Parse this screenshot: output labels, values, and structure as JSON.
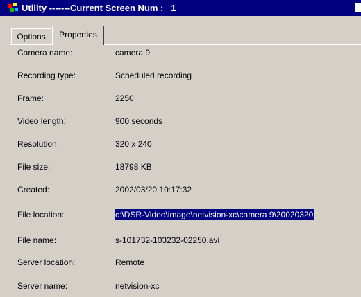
{
  "window": {
    "title": "Utility -------Current Screen Num :   1"
  },
  "tabs": [
    {
      "label": "Options",
      "active": false
    },
    {
      "label": "Properties",
      "active": true
    }
  ],
  "properties": [
    {
      "label": "Camera name:",
      "value": "camera 9"
    },
    {
      "label": "Recording type:",
      "value": "Scheduled recording"
    },
    {
      "label": "Frame:",
      "value": "2250"
    },
    {
      "label": "Video length:",
      "value": "900 seconds"
    },
    {
      "label": "Resolution:",
      "value": "320 x 240"
    },
    {
      "label": "File size:",
      "value": "18798 KB"
    },
    {
      "label": "Created:",
      "value": "2002/03/20 10:17:32"
    },
    {
      "label": "File location:",
      "value": "c:\\DSR-Video\\image\\netvision-xc\\camera 9\\20020320",
      "selected": true
    },
    {
      "label": "File name:",
      "value": "s-101732-103232-02250.avi"
    },
    {
      "label": "Server location:",
      "value": "Remote"
    },
    {
      "label": "Server name:",
      "value": "netvision-xc"
    }
  ],
  "colors": {
    "titlebar": "#000080",
    "face": "#d4d0c8",
    "selection": "#000080"
  }
}
